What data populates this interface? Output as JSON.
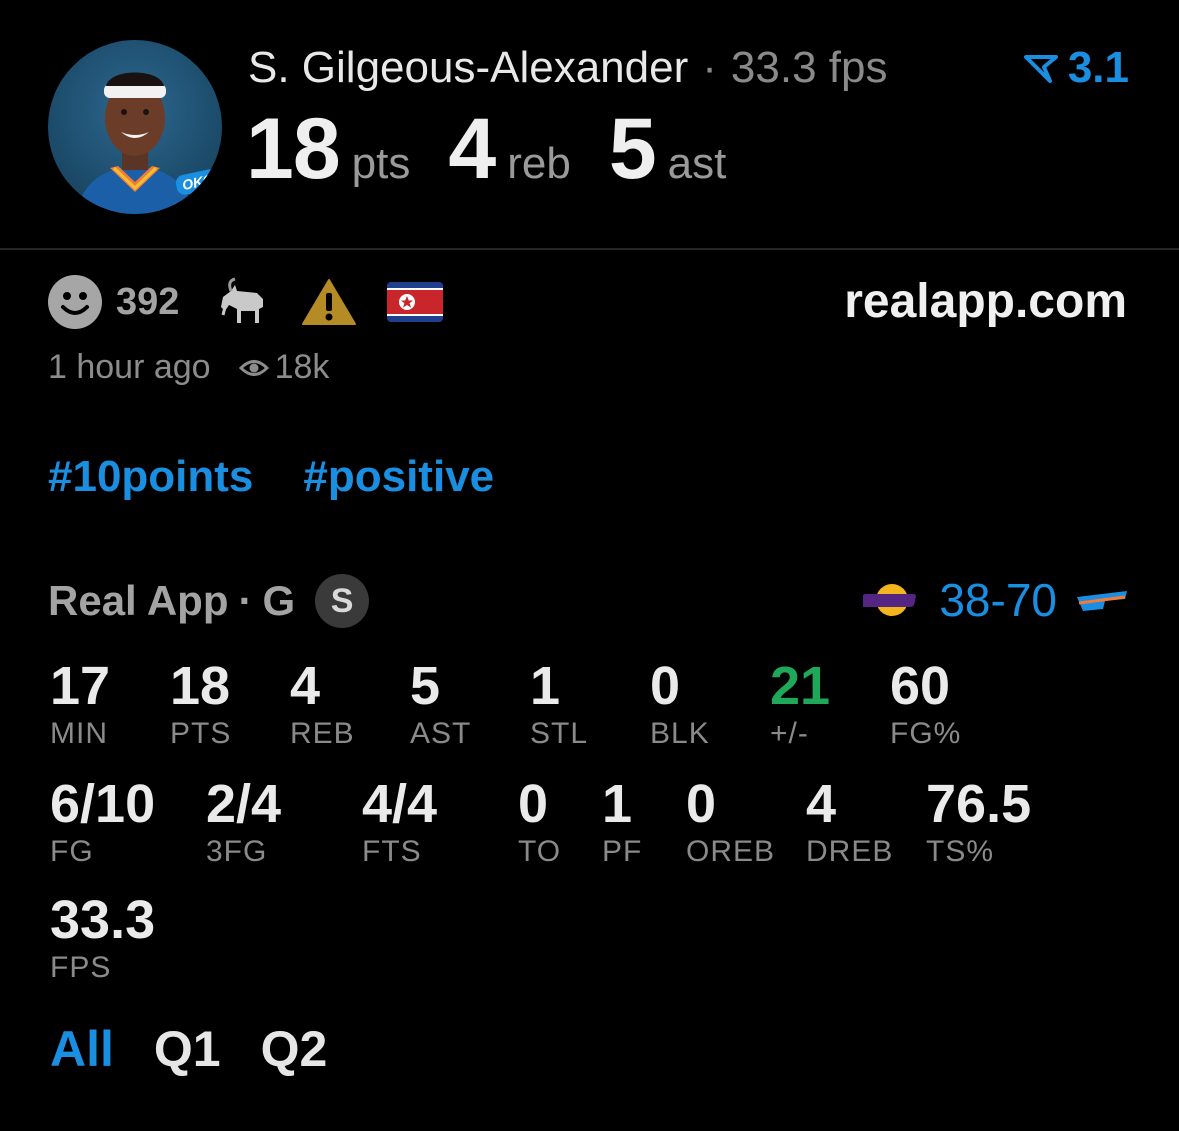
{
  "header": {
    "player_name": "S. Gilgeous-Alexander",
    "separator": "·",
    "fps_text": "33.3 fps",
    "rating": "3.1",
    "points_value": "18",
    "points_unit": "pts",
    "rebounds_value": "4",
    "rebounds_unit": "reb",
    "assists_value": "5",
    "assists_unit": "ast",
    "team_badge": "OKC"
  },
  "reactions": {
    "smile_count": "392",
    "icons": [
      "smile-icon",
      "goat-icon",
      "warning-icon",
      "flag-icon"
    ],
    "site": "realapp.com"
  },
  "meta": {
    "time_ago": "1 hour ago",
    "views": "18k"
  },
  "tags": [
    "#10points",
    "#positive"
  ],
  "game": {
    "source": "Real App",
    "separator": "·",
    "position": "G",
    "badge": "S",
    "score": "38-70",
    "away_team": "Lakers",
    "home_team": "OKC"
  },
  "stats": [
    {
      "value": "17",
      "label": "MIN"
    },
    {
      "value": "18",
      "label": "PTS"
    },
    {
      "value": "4",
      "label": "REB"
    },
    {
      "value": "5",
      "label": "AST"
    },
    {
      "value": "1",
      "label": "STL"
    },
    {
      "value": "0",
      "label": "BLK"
    },
    {
      "value": "21",
      "label": "+/-"
    },
    {
      "value": "60",
      "label": "FG%"
    },
    {
      "value": "6/10",
      "label": "FG"
    },
    {
      "value": "2/4",
      "label": "3FG"
    },
    {
      "value": "4/4",
      "label": "FTS"
    },
    {
      "value": "0",
      "label": "TO"
    },
    {
      "value": "1",
      "label": "PF"
    },
    {
      "value": "0",
      "label": "OREB"
    },
    {
      "value": "4",
      "label": "DREB"
    },
    {
      "value": "76.5",
      "label": "TS%"
    },
    {
      "value": "33.3",
      "label": "FPS"
    }
  ],
  "tabs": [
    {
      "label": "All",
      "active": true
    },
    {
      "label": "Q1",
      "active": false
    },
    {
      "label": "Q2",
      "active": false
    }
  ],
  "colors": {
    "accent": "#1a8ee0",
    "positive": "#1fa75a",
    "background": "#000000"
  }
}
